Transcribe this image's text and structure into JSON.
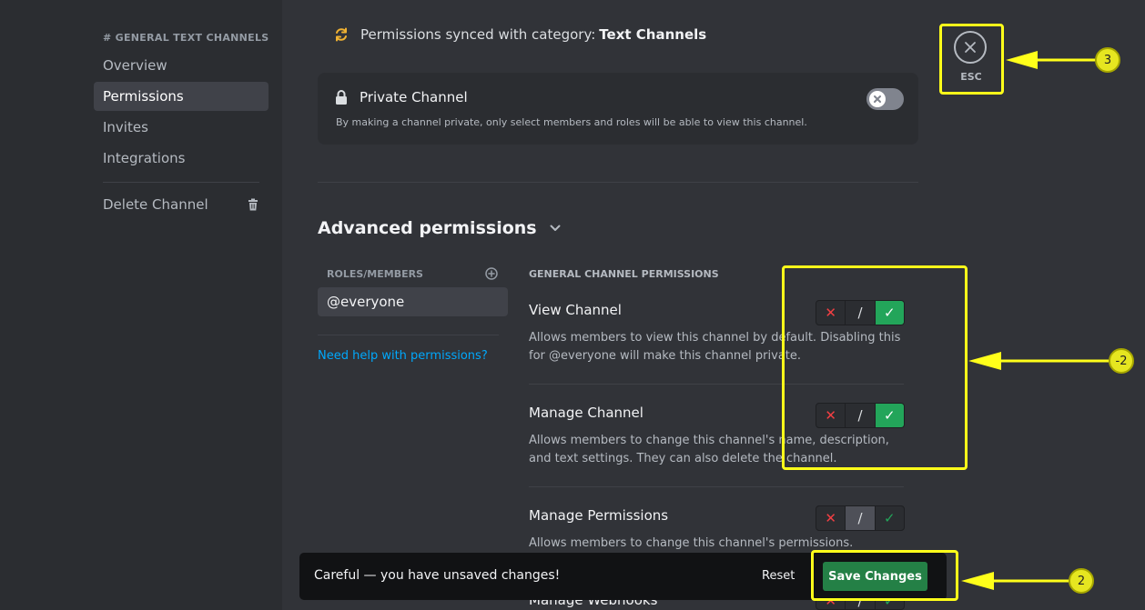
{
  "sidebar": {
    "header": "# GENERAL TEXT CHANNELS",
    "items": [
      {
        "label": "Overview"
      },
      {
        "label": "Permissions"
      },
      {
        "label": "Invites"
      },
      {
        "label": "Integrations"
      }
    ],
    "delete_label": "Delete Channel"
  },
  "sync": {
    "prefix": "Permissions synced with category:",
    "category": "Text Channels"
  },
  "private_channel": {
    "title": "Private Channel",
    "description": "By making a channel private, only select members and roles will be able to view this channel.",
    "enabled": false
  },
  "advanced": {
    "title": "Advanced permissions",
    "roles_label": "ROLES/MEMBERS",
    "selected_role": "@everyone",
    "help_link": "Need help with permissions?",
    "permissions_header": "GENERAL CHANNEL PERMISSIONS",
    "permissions": [
      {
        "title": "View Channel",
        "description": "Allows members to view this channel by default. Disabling this for @everyone will make this channel private.",
        "state": "allow"
      },
      {
        "title": "Manage Channel",
        "description": "Allows members to change this channel's name, description, and text settings. They can also delete the channel.",
        "state": "allow"
      },
      {
        "title": "Manage Permissions",
        "description": "Allows members to change this channel's permissions.",
        "state": "neutral"
      },
      {
        "title": "Manage Webhooks",
        "description": "",
        "state": "neutral"
      }
    ],
    "deny_symbol": "✕",
    "neutral_symbol": "/",
    "allow_symbol": "✓"
  },
  "unsaved_bar": {
    "message": "Careful — you have unsaved changes!",
    "reset_label": "Reset",
    "save_label": "Save Changes"
  },
  "close": {
    "label": "ESC"
  },
  "annotations": {
    "esc_marker": "3",
    "permissions_marker": "-2",
    "save_marker": "2",
    "color": "#ffff1a"
  }
}
